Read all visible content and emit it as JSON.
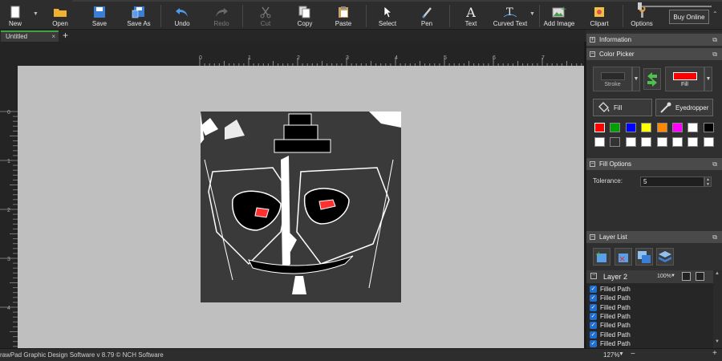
{
  "toolbar": {
    "new": "New",
    "open": "Open",
    "save": "Save",
    "save_as": "Save As",
    "undo": "Undo",
    "redo": "Redo",
    "cut": "Cut",
    "copy": "Copy",
    "paste": "Paste",
    "select": "Select",
    "pen": "Pen",
    "text": "Text",
    "curved_text": "Curved Text",
    "add_image": "Add Image",
    "clipart": "Clipart",
    "options": "Options",
    "buy_online": "Buy Online"
  },
  "tabs": {
    "active": "Untitled"
  },
  "ruler": {
    "horizontal": [
      "0",
      "1",
      "2",
      "3",
      "4",
      "5",
      "6",
      "7"
    ],
    "vertical": [
      "0",
      "1",
      "2",
      "3",
      "4"
    ]
  },
  "panels": {
    "information": "Information",
    "color_picker": "Color Picker",
    "stroke_label": "Stroke",
    "fill_label": "Fill",
    "fill_button": "Fill",
    "eyedropper_button": "Eyedropper",
    "fill_options": "Fill Options",
    "tolerance_label": "Tolerance:",
    "tolerance_value": "5",
    "layer_list": "Layer List",
    "layer_name": "Layer 2",
    "layer_zoom": "100%",
    "items": [
      "Filled Path",
      "Filled Path",
      "Filled Path",
      "Filled Path",
      "Filled Path",
      "Filled Path",
      "Filled Path"
    ]
  },
  "colors": {
    "stroke": "#2a2a2a",
    "fill": "#ff0000",
    "swatches_row1": [
      "#ff0000",
      "#00a000",
      "#0000ff",
      "#ffff00",
      "#ff8800",
      "#ff00ff",
      "#ffffff",
      "#000000"
    ],
    "swatches_row2": [
      "#ffffff",
      "#333333",
      "#ffffff",
      "#ffffff",
      "#ffffff",
      "#ffffff",
      "#ffffff",
      "#ffffff"
    ],
    "accent": "#3fa43f"
  },
  "status": {
    "text": "rawPad Graphic Design Software v 8.79 © NCH Software",
    "zoom": "127%"
  }
}
